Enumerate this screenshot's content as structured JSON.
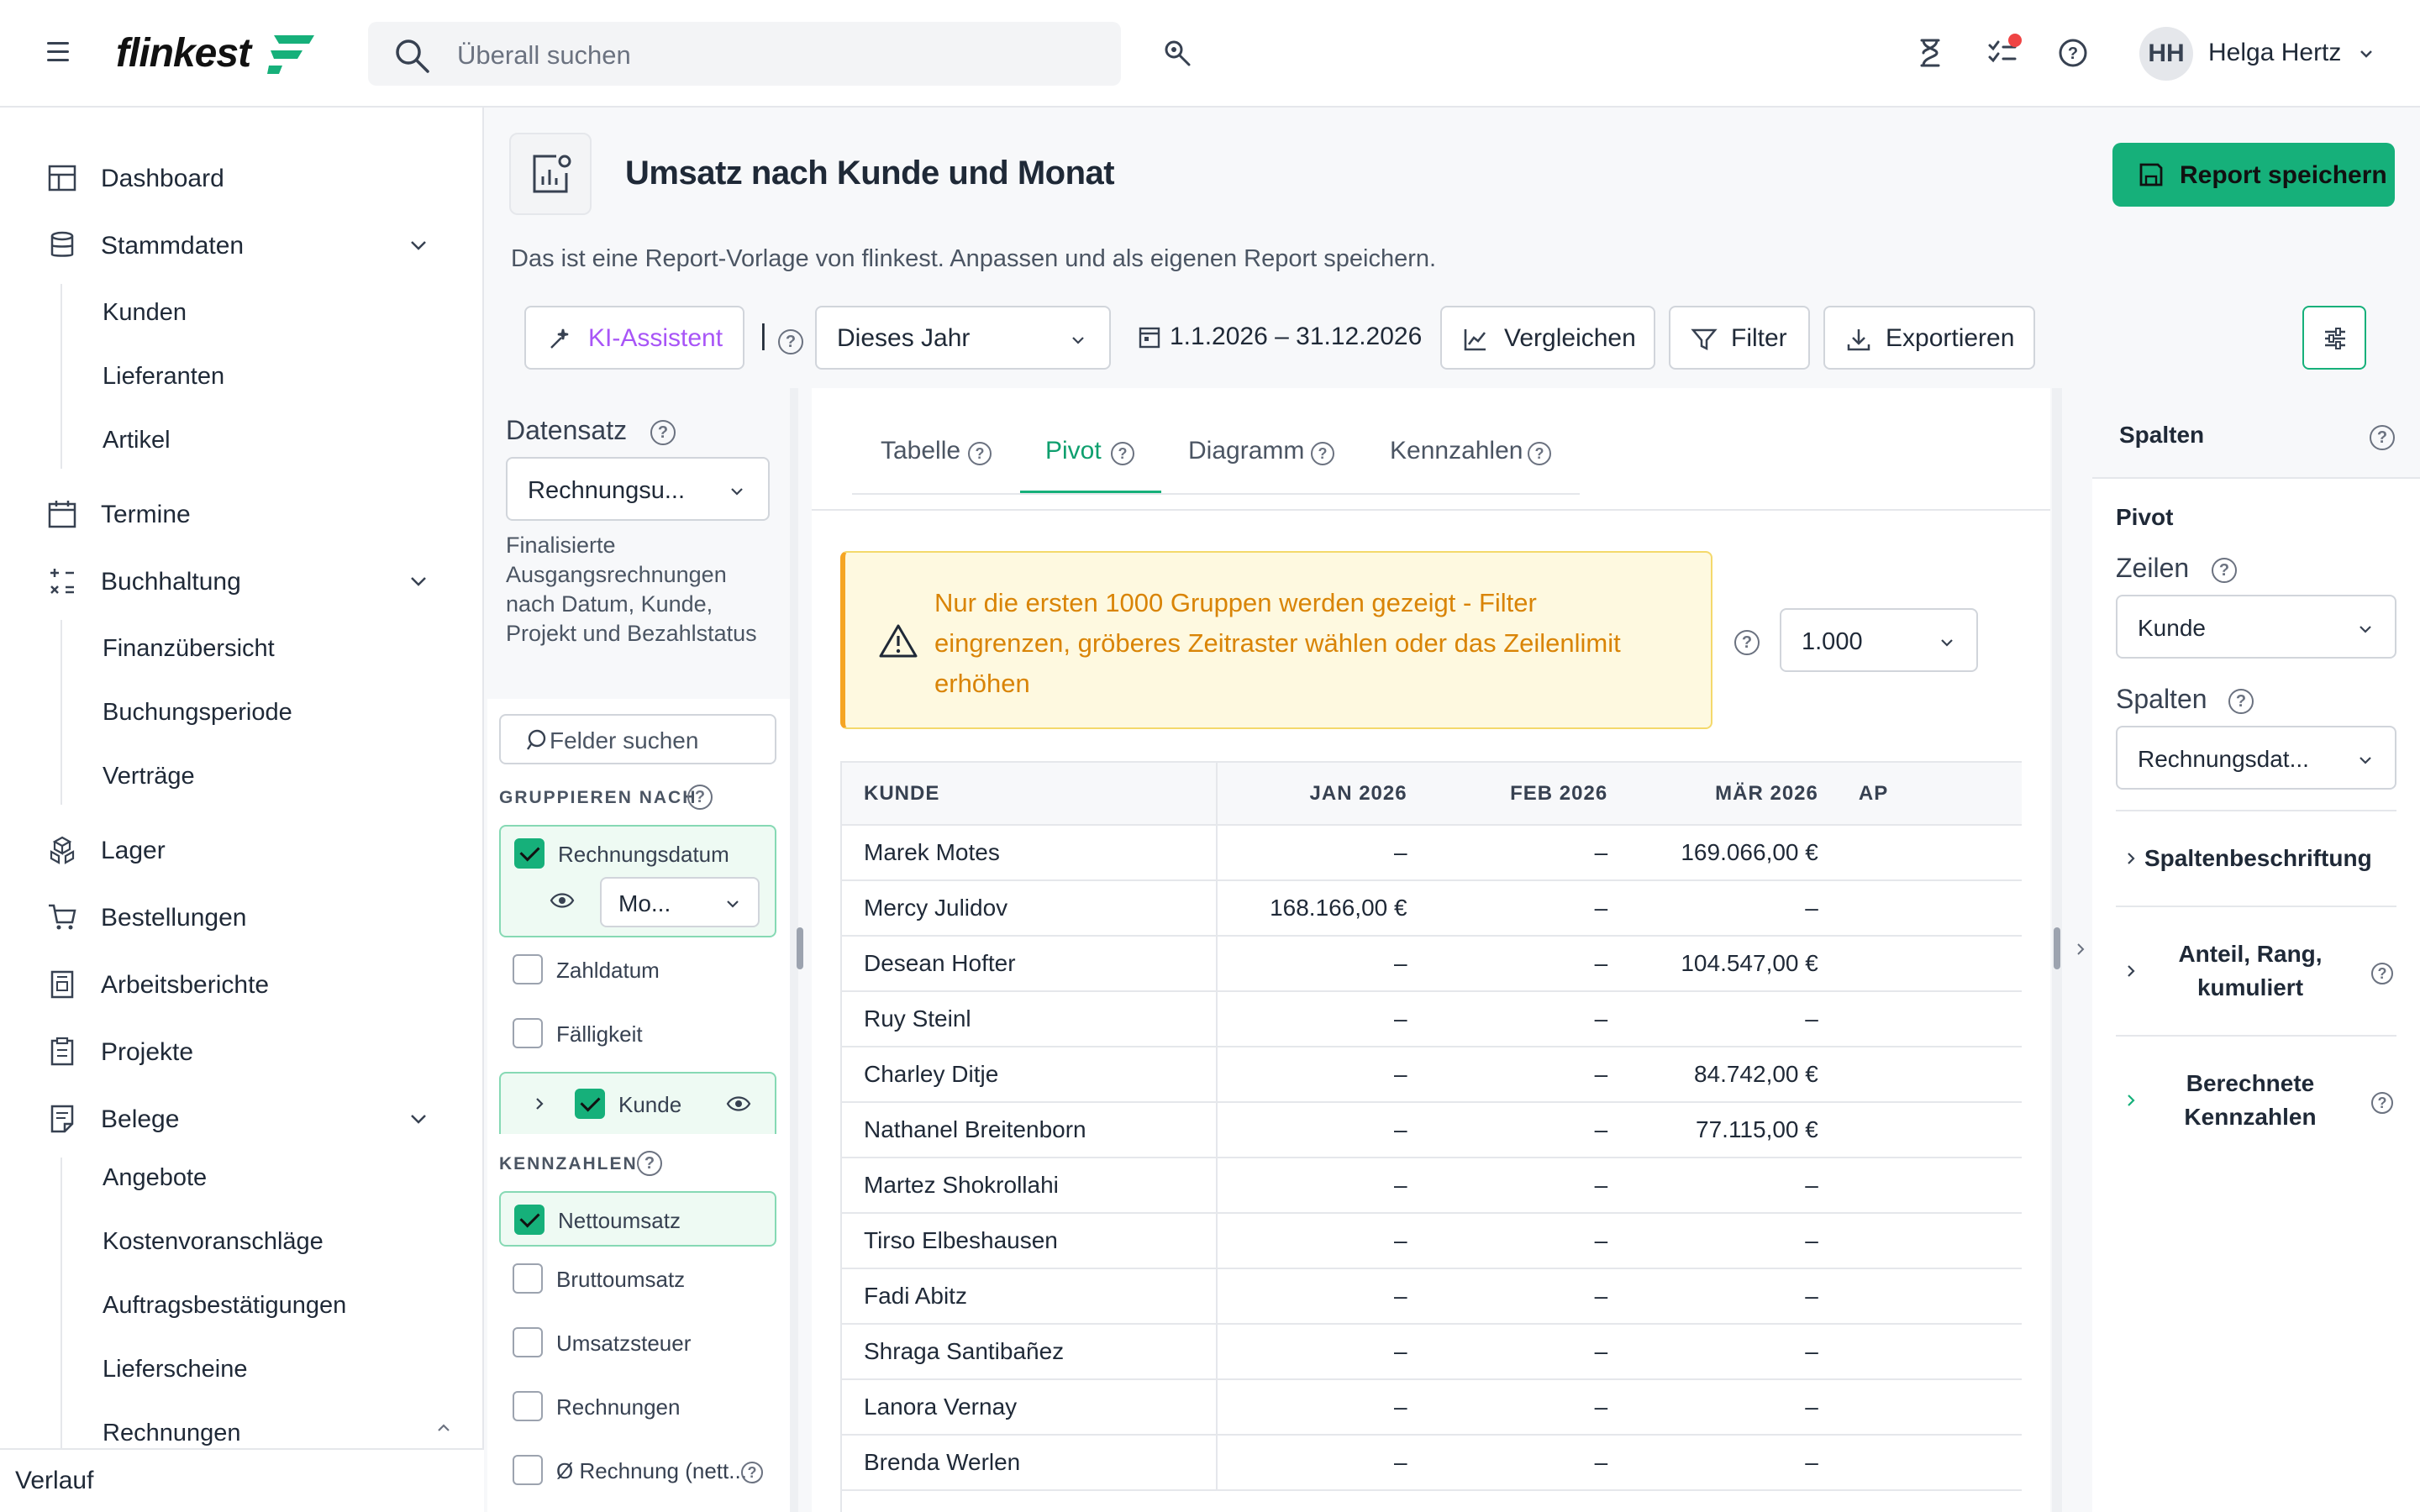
{
  "header": {
    "logo_text": "flinkest",
    "search_placeholder": "Überall suchen",
    "user_initials": "HH",
    "user_name": "Helga Hertz"
  },
  "sidebar": {
    "items": [
      {
        "label": "Dashboard",
        "icon": "dashboard-icon"
      },
      {
        "label": "Stammdaten",
        "icon": "database-icon",
        "expanded": true,
        "children": [
          "Kunden",
          "Lieferanten",
          "Artikel"
        ]
      },
      {
        "label": "Termine",
        "icon": "calendar-icon"
      },
      {
        "label": "Buchhaltung",
        "icon": "calculator-icon",
        "expanded": true,
        "children": [
          "Finanzübersicht",
          "Buchungsperiode",
          "Verträge"
        ]
      },
      {
        "label": "Lager",
        "icon": "boxes-icon"
      },
      {
        "label": "Bestellungen",
        "icon": "cart-icon"
      },
      {
        "label": "Arbeitsberichte",
        "icon": "report-icon"
      },
      {
        "label": "Projekte",
        "icon": "clipboard-icon"
      },
      {
        "label": "Belege",
        "icon": "document-icon",
        "expanded": true,
        "children": [
          "Angebote",
          "Kostenvoranschläge",
          "Auftragsbestätigungen",
          "Lieferscheine",
          "Rechnungen"
        ]
      }
    ],
    "footer": "Verlauf"
  },
  "report": {
    "title": "Umsatz nach Kunde und Monat",
    "save_label": "Report speichern",
    "description": "Das ist eine Report-Vorlage von flinkest. Anpassen und als eigenen Report speichern."
  },
  "toolbar": {
    "ai_label": "KI-Assistent",
    "separator": "|",
    "period": "Dieses Jahr",
    "date_range": "1.1.2026 – 31.12.2026",
    "compare_label": "Vergleichen",
    "filter_label": "Filter",
    "export_label": "Exportieren"
  },
  "left_panel": {
    "dataset_label": "Datensatz",
    "dataset_value": "Rechnungsu...",
    "dataset_description": "Finalisierte Ausgangsrechnungen nach Datum, Kunde, Projekt und Bezahlstatus",
    "field_search_placeholder": "Felder suchen",
    "group_by_label": "GRUPPIEREN NACH",
    "group_fields": [
      {
        "label": "Rechnungsdatum",
        "checked": true
      },
      {
        "label": "Zahldatum",
        "checked": false
      },
      {
        "label": "Fälligkeit",
        "checked": false
      },
      {
        "label": "Kunde",
        "checked": true
      }
    ],
    "date_granularity": "Mo...",
    "metrics_label": "KENNZAHLEN",
    "metric_fields": [
      {
        "label": "Nettoumsatz",
        "checked": true
      },
      {
        "label": "Bruttoumsatz",
        "checked": false
      },
      {
        "label": "Umsatzsteuer",
        "checked": false
      },
      {
        "label": "Rechnungen",
        "checked": false
      },
      {
        "label": "Ø Rechnung (nett...",
        "checked": false
      }
    ]
  },
  "tabs": [
    {
      "label": "Tabelle",
      "active": false
    },
    {
      "label": "Pivot",
      "active": true
    },
    {
      "label": "Diagramm",
      "active": false
    },
    {
      "label": "Kennzahlen",
      "active": false
    }
  ],
  "warning": {
    "text": "Nur die ersten 1000 Gruppen werden gezeigt - Filter eingrenzen, gröberes Zeitraster wählen oder das Zeilenlimit erhöhen",
    "limit_value": "1.000"
  },
  "pivot": {
    "columns": [
      "KUNDE",
      "JAN 2026",
      "FEB 2026",
      "MÄR 2026",
      "AP"
    ],
    "rows": [
      [
        "Marek Motes",
        "–",
        "–",
        "169.066,00 €"
      ],
      [
        "Mercy Julidov",
        "168.166,00 €",
        "–",
        "–"
      ],
      [
        "Desean Hofter",
        "–",
        "–",
        "104.547,00 €"
      ],
      [
        "Ruy Steinl",
        "–",
        "–",
        "–"
      ],
      [
        "Charley Ditje",
        "–",
        "–",
        "84.742,00 €"
      ],
      [
        "Nathanel Breitenborn",
        "–",
        "–",
        "77.115,00 €"
      ],
      [
        "Martez Shokrollahi",
        "–",
        "–",
        "–"
      ],
      [
        "Tirso Elbeshausen",
        "–",
        "–",
        "–"
      ],
      [
        "Fadi Abitz",
        "–",
        "–",
        "–"
      ],
      [
        "Shraga Santibañez",
        "–",
        "–",
        "–"
      ],
      [
        "Lanora Vernay",
        "–",
        "–",
        "–"
      ],
      [
        "Brenda Werlen",
        "–",
        "–",
        "–"
      ]
    ]
  },
  "right_panel": {
    "title": "Spalten",
    "section": "Pivot",
    "rows_label": "Zeilen",
    "rows_value": "Kunde",
    "cols_label": "Spalten",
    "cols_value": "Rechnungsdat...",
    "sections": [
      "Spaltenbeschriftung",
      "Anteil, Rang, kumuliert",
      "Berechnete Kennzahlen"
    ]
  },
  "colors": {
    "accent": "#16b07a",
    "warning_text": "#d98406",
    "warning_bg": "#fef9e0"
  }
}
